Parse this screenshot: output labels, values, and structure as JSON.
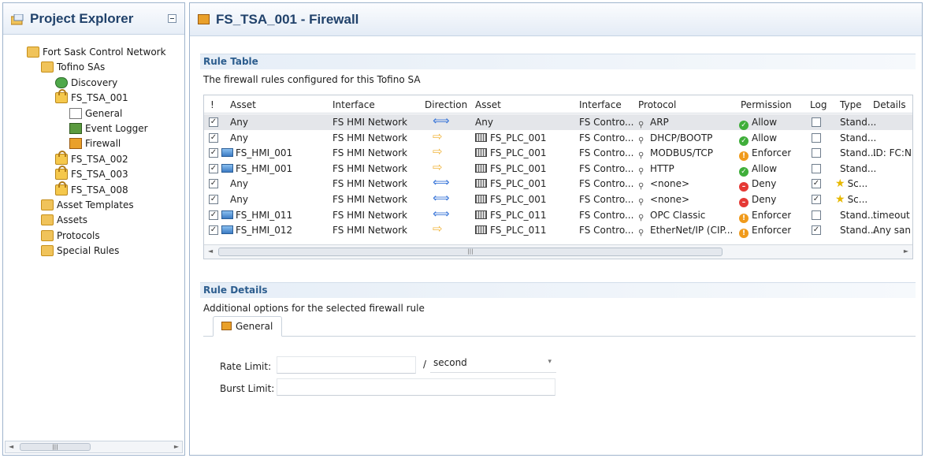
{
  "explorer": {
    "title": "Project Explorer",
    "tree": [
      {
        "label": "Fort Sask Control Network",
        "icon": "network-folder-icon",
        "level": 0
      },
      {
        "label": "Tofino SAs",
        "icon": "folder-icon",
        "level": 1
      },
      {
        "label": "Discovery",
        "icon": "discovery-icon",
        "level": 2
      },
      {
        "label": "FS_TSA_001",
        "icon": "lock-icon",
        "level": 2
      },
      {
        "label": "General",
        "icon": "general-icon",
        "level": 3
      },
      {
        "label": "Event Logger",
        "icon": "event-logger-icon",
        "level": 3
      },
      {
        "label": "Firewall",
        "icon": "firewall-icon",
        "level": 3,
        "selected": true
      },
      {
        "label": "FS_TSA_002",
        "icon": "lock-icon",
        "level": 2
      },
      {
        "label": "FS_TSA_003",
        "icon": "lock-icon",
        "level": 2
      },
      {
        "label": "FS_TSA_008",
        "icon": "lock-icon",
        "level": 2
      },
      {
        "label": "Asset Templates",
        "icon": "folder-icon",
        "level": 1
      },
      {
        "label": "Assets",
        "icon": "folder-icon",
        "level": 1
      },
      {
        "label": "Protocols",
        "icon": "folder-icon",
        "level": 1
      },
      {
        "label": "Special Rules",
        "icon": "folder-icon",
        "level": 1
      }
    ]
  },
  "editor": {
    "title": "FS_TSA_001 - Firewall"
  },
  "rule_table": {
    "section_title": "Rule Table",
    "description": "The firewall rules configured for this Tofino SA",
    "columns": [
      "!",
      "Asset",
      "Interface",
      "Direction",
      "Asset",
      "Interface",
      "Protocol",
      "Permission",
      "Log",
      "Type",
      "Details"
    ],
    "rows": [
      {
        "checked": true,
        "src_asset": "Any",
        "src_icon": "",
        "src_iface": "FS HMI Network",
        "direction": "both",
        "dst_asset": "Any",
        "dst_icon": "",
        "dst_iface": "FS Contro...",
        "protocol": "ARP",
        "permission": "Allow",
        "perm_kind": "allow",
        "log": false,
        "type": "Stand...",
        "type_icon": "",
        "details": "",
        "selected": true
      },
      {
        "checked": true,
        "src_asset": "Any",
        "src_icon": "",
        "src_iface": "FS HMI Network",
        "direction": "one",
        "dst_asset": "FS_PLC_001",
        "dst_icon": "plc",
        "dst_iface": "FS Contro...",
        "protocol": "DHCP/BOOTP",
        "permission": "Allow",
        "perm_kind": "allow",
        "log": false,
        "type": "Stand...",
        "type_icon": "",
        "details": ""
      },
      {
        "checked": true,
        "src_asset": "FS_HMI_001",
        "src_icon": "pc",
        "src_iface": "FS HMI Network",
        "direction": "one",
        "dst_asset": "FS_PLC_001",
        "dst_icon": "plc",
        "dst_iface": "FS Contro...",
        "protocol": "MODBUS/TCP",
        "permission": "Enforcer",
        "perm_kind": "enf",
        "log": false,
        "type": "Stand...",
        "type_icon": "",
        "details": "ID: FC:N"
      },
      {
        "checked": true,
        "src_asset": "FS_HMI_001",
        "src_icon": "pc",
        "src_iface": "FS HMI Network",
        "direction": "one",
        "dst_asset": "FS_PLC_001",
        "dst_icon": "plc",
        "dst_iface": "FS Contro...",
        "protocol": "HTTP",
        "permission": "Allow",
        "perm_kind": "allow",
        "log": false,
        "type": "Stand...",
        "type_icon": "",
        "details": ""
      },
      {
        "checked": true,
        "src_asset": "Any",
        "src_icon": "",
        "src_iface": "FS HMI Network",
        "direction": "both",
        "dst_asset": "FS_PLC_001",
        "dst_icon": "plc",
        "dst_iface": "FS Contro...",
        "protocol": "<none>",
        "permission": "Deny",
        "perm_kind": "deny",
        "log": true,
        "type": "Sc...",
        "type_icon": "star",
        "details": ""
      },
      {
        "checked": true,
        "src_asset": "Any",
        "src_icon": "",
        "src_iface": "FS HMI Network",
        "direction": "both",
        "dst_asset": "FS_PLC_001",
        "dst_icon": "plc",
        "dst_iface": "FS Contro...",
        "protocol": "<none>",
        "permission": "Deny",
        "perm_kind": "deny",
        "log": true,
        "type": "Sc...",
        "type_icon": "star",
        "details": ""
      },
      {
        "checked": true,
        "src_asset": "FS_HMI_011",
        "src_icon": "pc",
        "src_iface": "FS HMI Network",
        "direction": "both",
        "dst_asset": "FS_PLC_011",
        "dst_icon": "plc",
        "dst_iface": "FS Contro...",
        "protocol": "OPC Classic",
        "permission": "Enforcer",
        "perm_kind": "enf",
        "log": false,
        "type": "Stand...",
        "type_icon": "",
        "details": "timeout"
      },
      {
        "checked": true,
        "src_asset": "FS_HMI_012",
        "src_icon": "pc",
        "src_iface": "FS HMI Network",
        "direction": "one",
        "dst_asset": "FS_PLC_011",
        "dst_icon": "plc",
        "dst_iface": "FS Contro...",
        "protocol": "EtherNet/IP (CIP...",
        "permission": "Enforcer",
        "perm_kind": "enf",
        "log": true,
        "type": "Stand...",
        "type_icon": "",
        "details": "Any san"
      }
    ]
  },
  "rule_details": {
    "section_title": "Rule Details",
    "description": "Additional options for the selected firewall rule",
    "tab_label": "General",
    "rate_limit_label": "Rate Limit:",
    "rate_limit_value": "",
    "rate_separator": "/",
    "rate_unit": "second",
    "burst_limit_label": "Burst Limit:",
    "burst_limit_value": ""
  }
}
